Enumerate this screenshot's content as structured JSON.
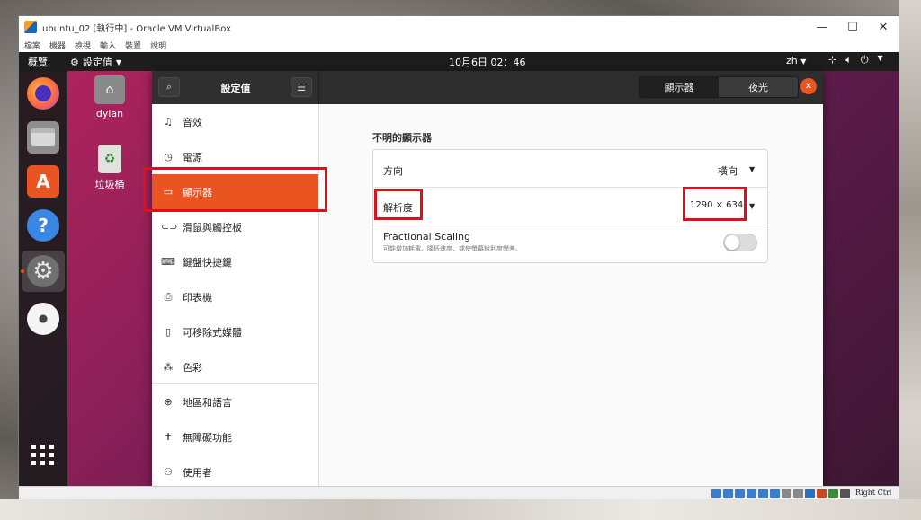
{
  "vbox": {
    "title": "ubuntu_02 [執行中] - Oracle VM VirtualBox",
    "menu": [
      "檔案",
      "機器",
      "檢視",
      "輸入",
      "裝置",
      "說明"
    ],
    "status_host_key": "Right Ctrl"
  },
  "topbar": {
    "activities": "概覽",
    "app_menu": "設定值",
    "clock": "10月6日  02：46",
    "lang": "zh"
  },
  "desktop": {
    "home_label": "dylan",
    "trash_label": "垃圾桶"
  },
  "settings": {
    "title": "設定值",
    "tabs": [
      "顯示器",
      "夜光"
    ],
    "sidebar": [
      {
        "label": "音效",
        "icon": "music-note-icon"
      },
      {
        "label": "電源",
        "icon": "power-icon"
      },
      {
        "label": "顯示器",
        "icon": "display-icon"
      },
      {
        "label": "滑鼠與觸控板",
        "icon": "mouse-icon"
      },
      {
        "label": "鍵盤快捷鍵",
        "icon": "keyboard-icon"
      },
      {
        "label": "印表機",
        "icon": "printer-icon"
      },
      {
        "label": "可移除式媒體",
        "icon": "removable-media-icon"
      },
      {
        "label": "色彩",
        "icon": "color-icon"
      },
      {
        "label": "地區和語言",
        "icon": "globe-icon"
      },
      {
        "label": "無障礙功能",
        "icon": "accessibility-icon"
      },
      {
        "label": "使用者",
        "icon": "users-icon"
      }
    ],
    "section_title": "不明的顯示器",
    "orientation": {
      "label": "方向",
      "value": "橫向"
    },
    "resolution": {
      "label": "解析度",
      "value": "1290 × 634"
    },
    "fractional": {
      "label": "Fractional Scaling",
      "desc": "可能增加耗電、降低速度、或使螢幕銳利度變差。",
      "enabled": false
    }
  },
  "colors": {
    "accent": "#e95420",
    "highlight": "#e0101a"
  }
}
